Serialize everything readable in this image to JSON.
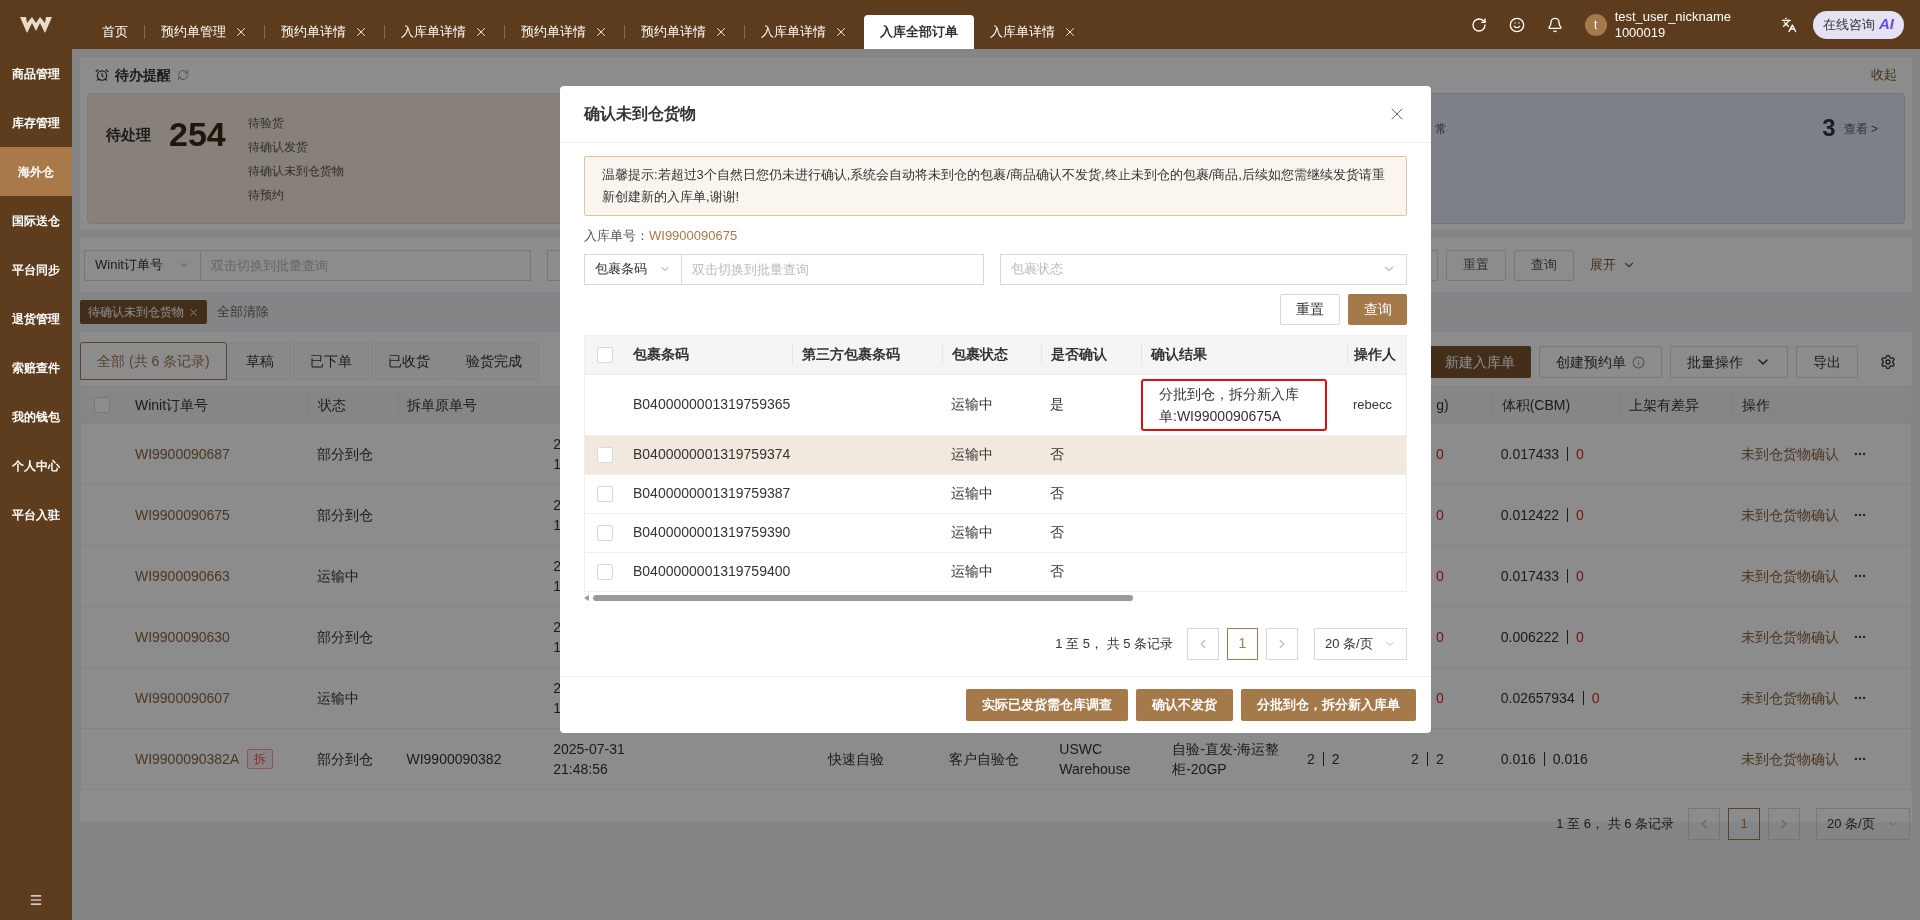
{
  "topbar": {
    "tabs": [
      {
        "label": "首页",
        "closable": false,
        "selected": false
      },
      {
        "label": "预约单管理",
        "closable": true,
        "selected": false
      },
      {
        "label": "预约单详情",
        "closable": true,
        "selected": false
      },
      {
        "label": "入库单详情",
        "closable": true,
        "selected": false
      },
      {
        "label": "预约单详情",
        "closable": true,
        "selected": false
      },
      {
        "label": "预约单详情",
        "closable": true,
        "selected": false
      },
      {
        "label": "入库单详情",
        "closable": true,
        "selected": false
      },
      {
        "label": "入库全部订单",
        "closable": false,
        "selected": true
      },
      {
        "label": "入库单详情",
        "closable": true,
        "selected": false
      }
    ],
    "user": {
      "avatar_letter": "t",
      "name": "test_user_nickname",
      "id": "1000019"
    },
    "consult_button": {
      "label": "在线咨询",
      "badge": "AI"
    }
  },
  "sidebar": {
    "items": [
      {
        "label": "商品管理",
        "selected": false
      },
      {
        "label": "库存管理",
        "selected": false
      },
      {
        "label": "海外仓",
        "selected": true
      },
      {
        "label": "国际送仓",
        "selected": false
      },
      {
        "label": "平台同步",
        "selected": false
      },
      {
        "label": "退货管理",
        "selected": false
      },
      {
        "label": "索赔查件",
        "selected": false
      },
      {
        "label": "我的钱包",
        "selected": false
      },
      {
        "label": "个人中心",
        "selected": false
      },
      {
        "label": "平台入驻",
        "selected": false
      }
    ]
  },
  "reminder": {
    "title": "待办提醒",
    "collapse_link": "收起",
    "pending": {
      "label": "待处理",
      "count": "254",
      "items": [
        "待验货",
        "待确认发货",
        "待确认未到仓货物",
        "待预约"
      ]
    },
    "exception": {
      "label": "常",
      "count": "3",
      "link": "查看 >"
    }
  },
  "search": {
    "field_select": "Winit订单号",
    "placeholder": "双击切换到批量查询",
    "buttons": [
      "重置",
      "查询"
    ],
    "expand": "展开"
  },
  "filters": {
    "tags": [
      "待确认未到仓货物"
    ],
    "clear": "全部清除"
  },
  "status_tabs": [
    {
      "label": "全部 (共 6 条记录)",
      "selected": true
    },
    {
      "label": "草稿",
      "selected": false
    },
    {
      "label": "已下单",
      "selected": false
    },
    {
      "label": "已收货",
      "selected": false
    },
    {
      "label": "验货完成",
      "selected": false
    }
  ],
  "actions": [
    {
      "label": "新建入库单",
      "kind": "primary"
    },
    {
      "label": "创建预约单",
      "kind": "info"
    },
    {
      "label": "批量操作",
      "kind": "dropdown"
    },
    {
      "label": "导出",
      "kind": "plain"
    }
  ],
  "orders": {
    "select_all_checked": false,
    "columns": {
      "order_no": "Winit订单号",
      "status": "状态",
      "split_from": "拆单原单号",
      "weight": "g)",
      "volume": "体积(CBM)",
      "diff": "上架有差异",
      "ops": "操作"
    },
    "rows": [
      {
        "order_no": "WI9900090687",
        "status": "部分到仓",
        "date": [
          "2",
          "1"
        ],
        "weight": [
          {
            "text": "0",
            "alert": true
          }
        ],
        "volume": [
          {
            "text": "0.017433",
            "alert": false
          },
          {
            "text": "0",
            "alert": true
          }
        ],
        "action": "未到仓货物确认"
      },
      {
        "order_no": "WI9900090675",
        "status": "部分到仓",
        "date": [
          "2",
          "1"
        ],
        "weight": [
          {
            "text": "0",
            "alert": true
          }
        ],
        "volume": [
          {
            "text": "0.012422",
            "alert": false
          },
          {
            "text": "0",
            "alert": true
          }
        ],
        "action": "未到仓货物确认"
      },
      {
        "order_no": "WI9900090663",
        "status": "运输中",
        "date": [
          "2",
          "1"
        ],
        "weight": [
          {
            "text": "0",
            "alert": true
          }
        ],
        "volume": [
          {
            "text": "0.017433",
            "alert": false
          },
          {
            "text": "0",
            "alert": true
          }
        ],
        "action": "未到仓货物确认"
      },
      {
        "order_no": "WI9900090630",
        "status": "部分到仓",
        "date": [
          "2",
          "1"
        ],
        "weight": [
          {
            "text": "0",
            "alert": true
          }
        ],
        "volume": [
          {
            "text": "0.006222",
            "alert": false
          },
          {
            "text": "0",
            "alert": true
          }
        ],
        "action": "未到仓货物确认"
      },
      {
        "order_no": "WI9900090607",
        "status": "运输中",
        "date": [
          "2",
          "1"
        ],
        "weight": [
          {
            "text": "0",
            "alert": true
          }
        ],
        "volume": [
          {
            "text": "0.02657934",
            "alert": false
          },
          {
            "text": "0",
            "alert": true
          }
        ],
        "action": "未到仓货物确认"
      },
      {
        "order_no": "WI9900090382A",
        "split_tag": "拆",
        "status": "部分到仓",
        "split_from": "WI9900090382",
        "date": [
          "2025-07-31",
          "21:48:56"
        ],
        "check_type": "快速自验",
        "warehouse_type": "客户自验仓",
        "warehouse": "USWC Warehouse",
        "transport": "自验-直发-海运整柜-20GP",
        "quantity": [
          {
            "text": "2",
            "alert": false
          },
          {
            "text": "2",
            "alert": false
          }
        ],
        "weight": [
          {
            "text": "2",
            "alert": false
          },
          {
            "text": "2",
            "alert": false
          }
        ],
        "volume": [
          {
            "text": "0.016",
            "alert": false
          },
          {
            "text": "0.016",
            "alert": false
          }
        ],
        "action": "未到仓货物确认"
      }
    ],
    "pagination": {
      "summary": "1 至 6， 共 6 条记录",
      "page": "1",
      "page_size": "20 条/页"
    }
  },
  "modal": {
    "title": "确认未到仓货物",
    "notice": "温馨提示:若超过3个自然日您仍未进行确认,系统会自动将未到仓的包裹/商品确认不发货,终止未到仓的包裹/商品,后续如您需继续发货请重新创建新的入库单,谢谢!",
    "order_label": "入库单号：",
    "order_no": "WI9900090675",
    "filter": {
      "field_select": "包裹条码",
      "placeholder": "双击切换到批量查询",
      "status_placeholder": "包裹状态"
    },
    "buttons": [
      "重置",
      "查询"
    ],
    "select_all_checked": false,
    "columns": [
      "包裹条码",
      "第三方包裹条码",
      "包裹状态",
      "是否确认",
      "确认结果",
      "操作人"
    ],
    "rows": [
      {
        "selectable": false,
        "hovered": false,
        "barcode": "B0400000001319759365",
        "status": "运输中",
        "confirmed": "是",
        "result": "分批到仓，拆分新入库单:WI9900090675A",
        "result_highlighted": true,
        "operator": "rebecc"
      },
      {
        "selectable": true,
        "selected": false,
        "hovered": true,
        "barcode": "B0400000001319759374",
        "status": "运输中",
        "confirmed": "否"
      },
      {
        "selectable": true,
        "selected": false,
        "hovered": false,
        "barcode": "B0400000001319759387",
        "status": "运输中",
        "confirmed": "否"
      },
      {
        "selectable": true,
        "selected": false,
        "hovered": false,
        "barcode": "B0400000001319759390",
        "status": "运输中",
        "confirmed": "否"
      },
      {
        "selectable": true,
        "selected": false,
        "hovered": false,
        "barcode": "B0400000001319759400",
        "status": "运输中",
        "confirmed": "否"
      }
    ],
    "pagination": {
      "summary": "1 至 5， 共 5 条记录",
      "page": "1",
      "page_size": "20 条/页"
    },
    "footer_buttons": [
      "实际已发货需仓库调查",
      "确认不发货",
      "分批到仓，拆分新入库单"
    ]
  }
}
